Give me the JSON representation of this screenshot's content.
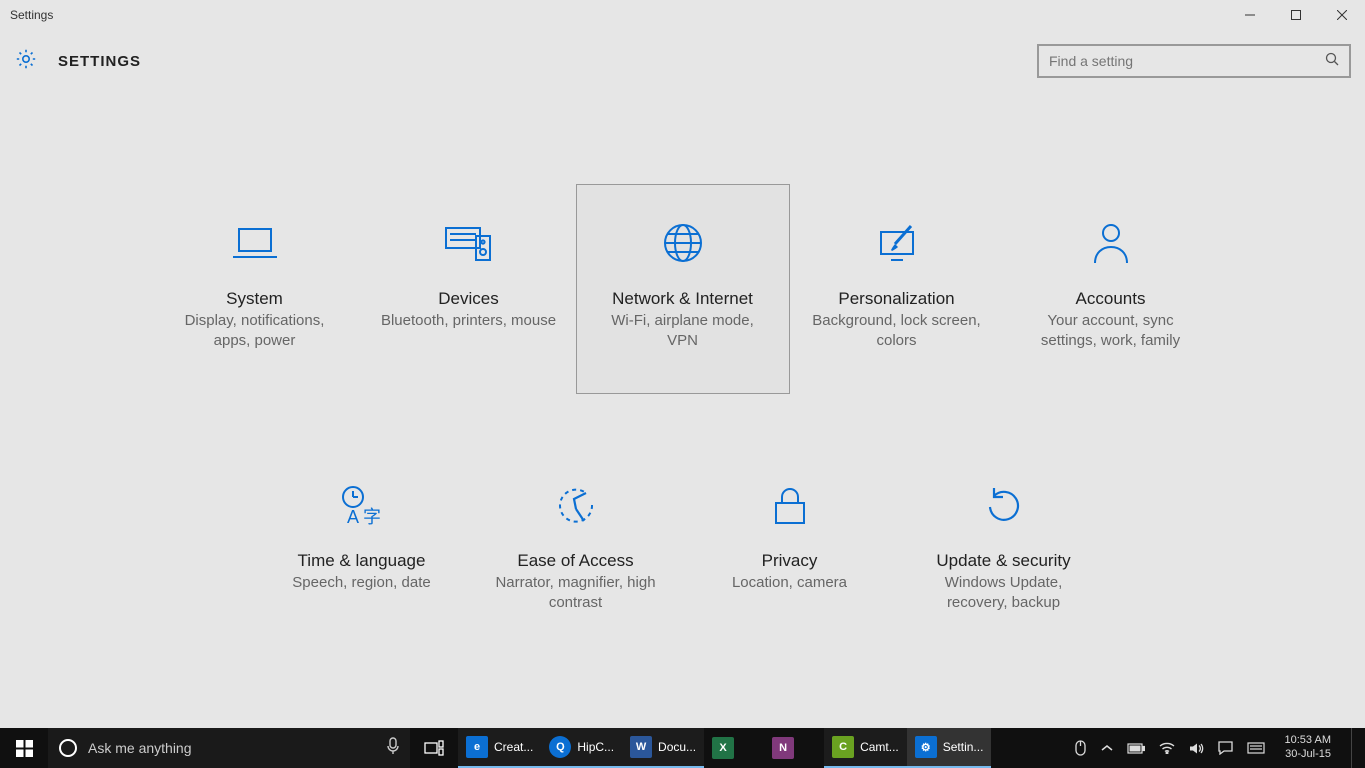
{
  "window": {
    "title": "Settings",
    "header_title": "SETTINGS"
  },
  "search": {
    "placeholder": "Find a setting"
  },
  "tiles": [
    {
      "id": "system",
      "title": "System",
      "desc": "Display, notifications, apps, power",
      "selected": false
    },
    {
      "id": "devices",
      "title": "Devices",
      "desc": "Bluetooth, printers, mouse",
      "selected": false
    },
    {
      "id": "network",
      "title": "Network & Internet",
      "desc": "Wi-Fi, airplane mode, VPN",
      "selected": true
    },
    {
      "id": "personalization",
      "title": "Personalization",
      "desc": "Background, lock screen, colors",
      "selected": false
    },
    {
      "id": "accounts",
      "title": "Accounts",
      "desc": "Your account, sync settings, work, family",
      "selected": false
    },
    {
      "id": "time",
      "title": "Time & language",
      "desc": "Speech, region, date",
      "selected": false
    },
    {
      "id": "ease",
      "title": "Ease of Access",
      "desc": "Narrator, magnifier, high contrast",
      "selected": false
    },
    {
      "id": "privacy",
      "title": "Privacy",
      "desc": "Location, camera",
      "selected": false
    },
    {
      "id": "update",
      "title": "Update & security",
      "desc": "Windows Update, recovery, backup",
      "selected": false
    }
  ],
  "taskbar": {
    "cortana_placeholder": "Ask me anything",
    "apps": [
      {
        "id": "edge",
        "label": "Creat...",
        "icon": "e",
        "state": "running"
      },
      {
        "id": "hipchat",
        "label": "HipC...",
        "icon": "Q",
        "state": "running"
      },
      {
        "id": "word",
        "label": "Docu...",
        "icon": "W",
        "state": "running"
      },
      {
        "id": "excel",
        "label": "",
        "icon": "X",
        "state": "pinned"
      },
      {
        "id": "onenote",
        "label": "",
        "icon": "N",
        "state": "pinned"
      },
      {
        "id": "camtasia",
        "label": "Camt...",
        "icon": "C",
        "state": "running"
      },
      {
        "id": "settings",
        "label": "Settin...",
        "icon": "⚙",
        "state": "active"
      }
    ],
    "clock_time": "10:53 AM",
    "clock_date": "30-Jul-15"
  }
}
